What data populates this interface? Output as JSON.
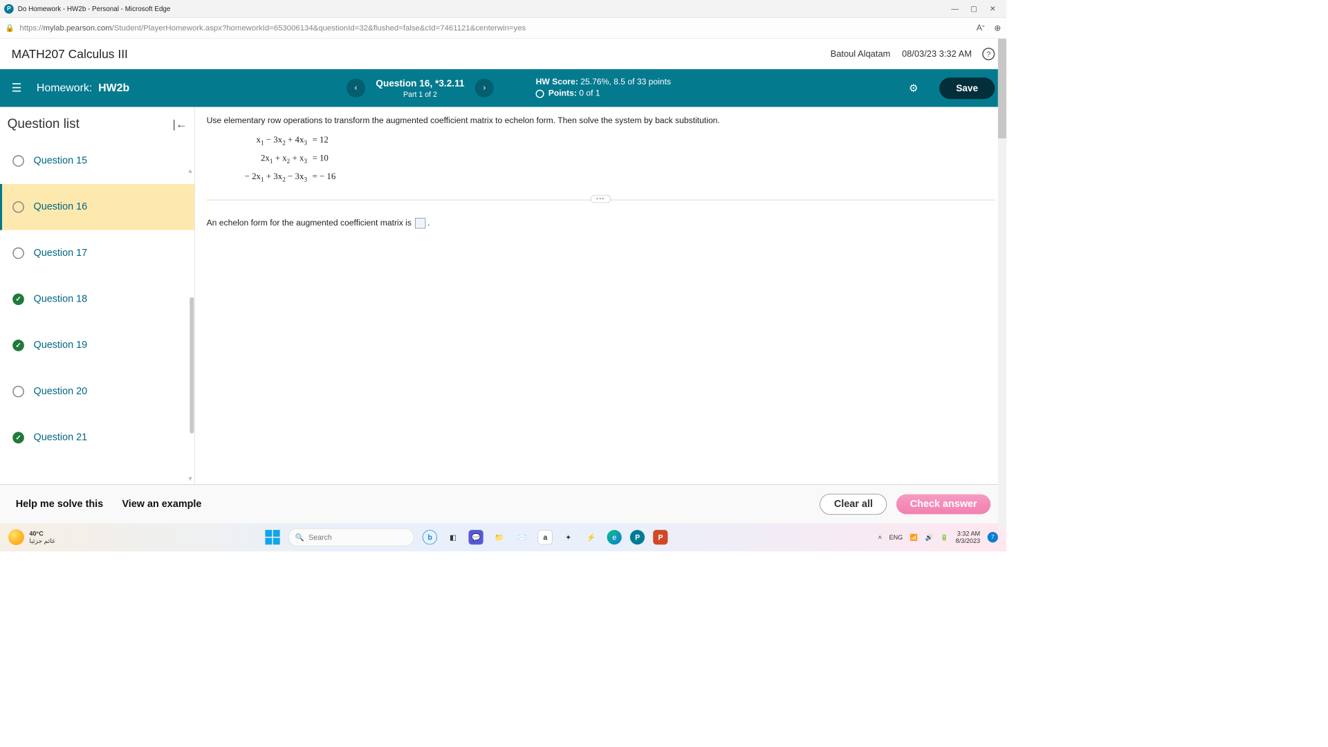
{
  "window": {
    "title": "Do Homework - HW2b - Personal - Microsoft Edge"
  },
  "url": {
    "host": "mylab.pearson.com",
    "path": "/Student/PlayerHomework.aspx?homeworkId=653006134&questionId=32&flushed=false&cId=7461121&centerwin=yes"
  },
  "header": {
    "course": "MATH207 Calculus III",
    "user": "Batoul Alqatam",
    "datetime": "08/03/23 3:32 AM"
  },
  "hwbar": {
    "label_prefix": "Homework:",
    "label_name": "HW2b",
    "question_main": "Question 16, *3.2.11",
    "question_sub": "Part 1 of 2",
    "hw_score_label": "HW Score:",
    "hw_score_value": "25.76%, 8.5 of 33 points",
    "points_label": "Points:",
    "points_value": "0 of 1",
    "save": "Save"
  },
  "sidebar": {
    "title": "Question list",
    "items": [
      {
        "label": "Question 15",
        "status": "empty"
      },
      {
        "label": "Question 16",
        "status": "empty",
        "active": true
      },
      {
        "label": "Question 17",
        "status": "empty"
      },
      {
        "label": "Question 18",
        "status": "done"
      },
      {
        "label": "Question 19",
        "status": "done"
      },
      {
        "label": "Question 20",
        "status": "empty"
      },
      {
        "label": "Question 21",
        "status": "done"
      }
    ]
  },
  "content": {
    "instruction": "Use elementary row operations to transform the augmented coefficient matrix to echelon form. Then solve the system by back substitution.",
    "eq1_rhs": "12",
    "eq2_rhs": "10",
    "eq3_rhs": "− 16",
    "answer_prompt": "An echelon form for the augmented coefficient matrix is",
    "answer_suffix": "."
  },
  "footer": {
    "help": "Help me solve this",
    "example": "View an example",
    "clear": "Clear all",
    "check": "Check answer"
  },
  "taskbar": {
    "temp": "40°C",
    "temp_sub": "غائم جزئيا",
    "search_placeholder": "Search",
    "lang": "ENG",
    "time": "3:32 AM",
    "date": "8/3/2023",
    "notif": "7"
  }
}
